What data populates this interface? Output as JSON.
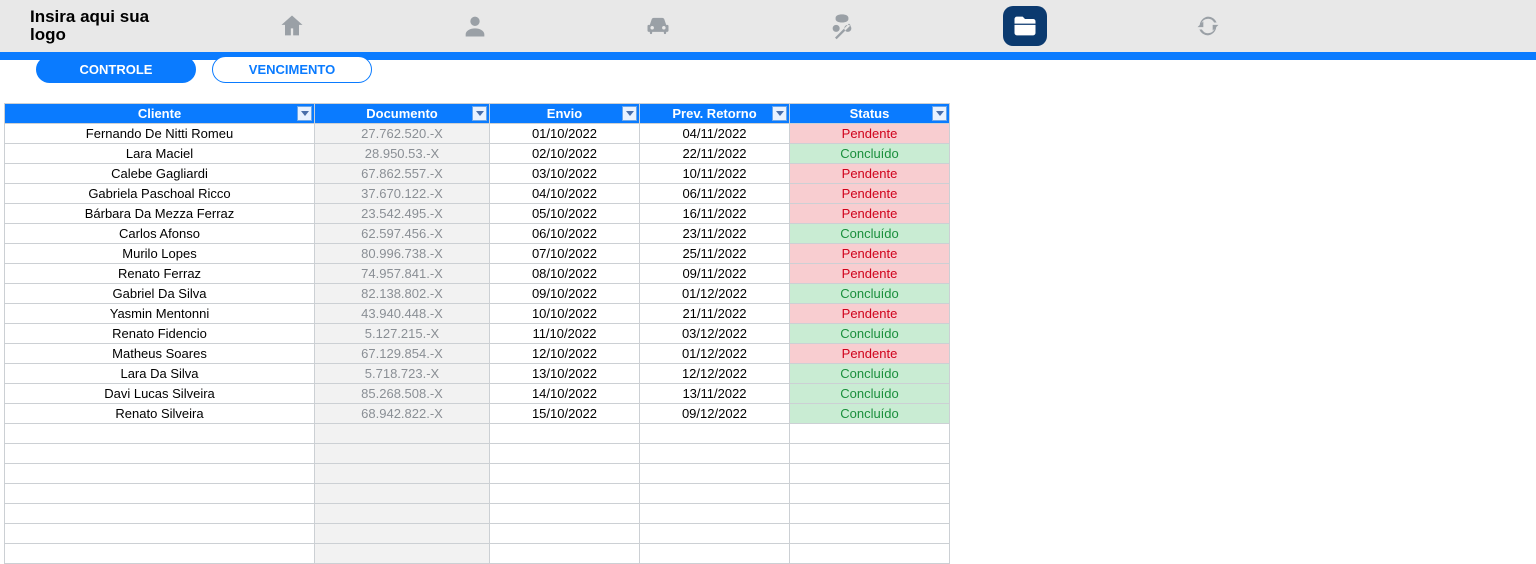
{
  "logo": {
    "line1": "Insira aqui sua",
    "line2": "logo"
  },
  "nav": [
    {
      "id": "home",
      "icon": "home",
      "active": false
    },
    {
      "id": "user",
      "icon": "user",
      "active": false
    },
    {
      "id": "car",
      "icon": "car",
      "active": false
    },
    {
      "id": "percent",
      "icon": "percent",
      "active": false
    },
    {
      "id": "folder",
      "icon": "folder",
      "active": true
    },
    {
      "id": "cycle",
      "icon": "cycle",
      "active": false
    }
  ],
  "tabs": {
    "controle": {
      "label": "CONTROLE",
      "active": true
    },
    "vencimento": {
      "label": "VENCIMENTO",
      "active": false
    }
  },
  "columns": {
    "cliente": "Cliente",
    "documento": "Documento",
    "envio": "Envio",
    "retorno": "Prev. Retorno",
    "status": "Status"
  },
  "status_labels": {
    "Pendente": "Pendente",
    "Concluído": "Concluído"
  },
  "rows": [
    {
      "cliente": "Fernando De Nitti Romeu",
      "documento": "27.762.520.-X",
      "envio": "01/10/2022",
      "retorno": "04/11/2022",
      "status": "Pendente"
    },
    {
      "cliente": "Lara Maciel",
      "documento": "28.950.53.-X",
      "envio": "02/10/2022",
      "retorno": "22/11/2022",
      "status": "Concluído"
    },
    {
      "cliente": "Calebe Gagliardi",
      "documento": "67.862.557.-X",
      "envio": "03/10/2022",
      "retorno": "10/11/2022",
      "status": "Pendente"
    },
    {
      "cliente": "Gabriela Paschoal Ricco",
      "documento": "37.670.122.-X",
      "envio": "04/10/2022",
      "retorno": "06/11/2022",
      "status": "Pendente"
    },
    {
      "cliente": "Bárbara Da Mezza Ferraz",
      "documento": "23.542.495.-X",
      "envio": "05/10/2022",
      "retorno": "16/11/2022",
      "status": "Pendente"
    },
    {
      "cliente": "Carlos Afonso",
      "documento": "62.597.456.-X",
      "envio": "06/10/2022",
      "retorno": "23/11/2022",
      "status": "Concluído"
    },
    {
      "cliente": "Murilo Lopes",
      "documento": "80.996.738.-X",
      "envio": "07/10/2022",
      "retorno": "25/11/2022",
      "status": "Pendente"
    },
    {
      "cliente": "Renato Ferraz",
      "documento": "74.957.841.-X",
      "envio": "08/10/2022",
      "retorno": "09/11/2022",
      "status": "Pendente"
    },
    {
      "cliente": "Gabriel Da Silva",
      "documento": "82.138.802.-X",
      "envio": "09/10/2022",
      "retorno": "01/12/2022",
      "status": "Concluído"
    },
    {
      "cliente": "Yasmin Mentonni",
      "documento": "43.940.448.-X",
      "envio": "10/10/2022",
      "retorno": "21/11/2022",
      "status": "Pendente"
    },
    {
      "cliente": "Renato Fidencio",
      "documento": "5.127.215.-X",
      "envio": "11/10/2022",
      "retorno": "03/12/2022",
      "status": "Concluído"
    },
    {
      "cliente": "Matheus Soares",
      "documento": "67.129.854.-X",
      "envio": "12/10/2022",
      "retorno": "01/12/2022",
      "status": "Pendente"
    },
    {
      "cliente": "Lara Da Silva",
      "documento": "5.718.723.-X",
      "envio": "13/10/2022",
      "retorno": "12/12/2022",
      "status": "Concluído"
    },
    {
      "cliente": "Davi Lucas Silveira",
      "documento": "85.268.508.-X",
      "envio": "14/10/2022",
      "retorno": "13/11/2022",
      "status": "Concluído"
    },
    {
      "cliente": "Renato Silveira",
      "documento": "68.942.822.-X",
      "envio": "15/10/2022",
      "retorno": "09/12/2022",
      "status": "Concluído"
    }
  ],
  "empty_rows": 7
}
